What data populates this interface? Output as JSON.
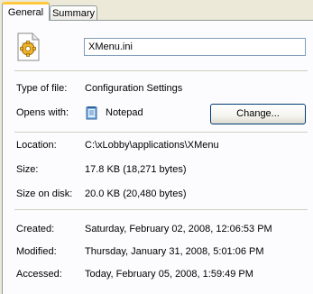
{
  "tabs": [
    {
      "label": "General"
    },
    {
      "label": "Summary"
    }
  ],
  "file": {
    "name": "XMenu.ini"
  },
  "type_of_file": {
    "label": "Type of file:",
    "value": "Configuration Settings"
  },
  "opens_with": {
    "label": "Opens with:",
    "app_name": "Notepad",
    "change_button_label": "Change..."
  },
  "location": {
    "label": "Location:",
    "value": "C:\\xLobby\\applications\\XMenu"
  },
  "size": {
    "label": "Size:",
    "value": "17.8 KB (18,271 bytes)"
  },
  "size_on_disk": {
    "label": "Size on disk:",
    "value": "20.0 KB (20,480 bytes)"
  },
  "created": {
    "label": "Created:",
    "value": "Saturday, February 02, 2008, 12:06:53 PM"
  },
  "modified": {
    "label": "Modified:",
    "value": "Thursday, January 31, 2008, 5:01:06 PM"
  },
  "accessed": {
    "label": "Accessed:",
    "value": "Today, February 05, 2008, 1:59:49 PM"
  },
  "icons": {
    "file_type_icon": "config-file-icon",
    "app_icon": "notepad-icon"
  }
}
